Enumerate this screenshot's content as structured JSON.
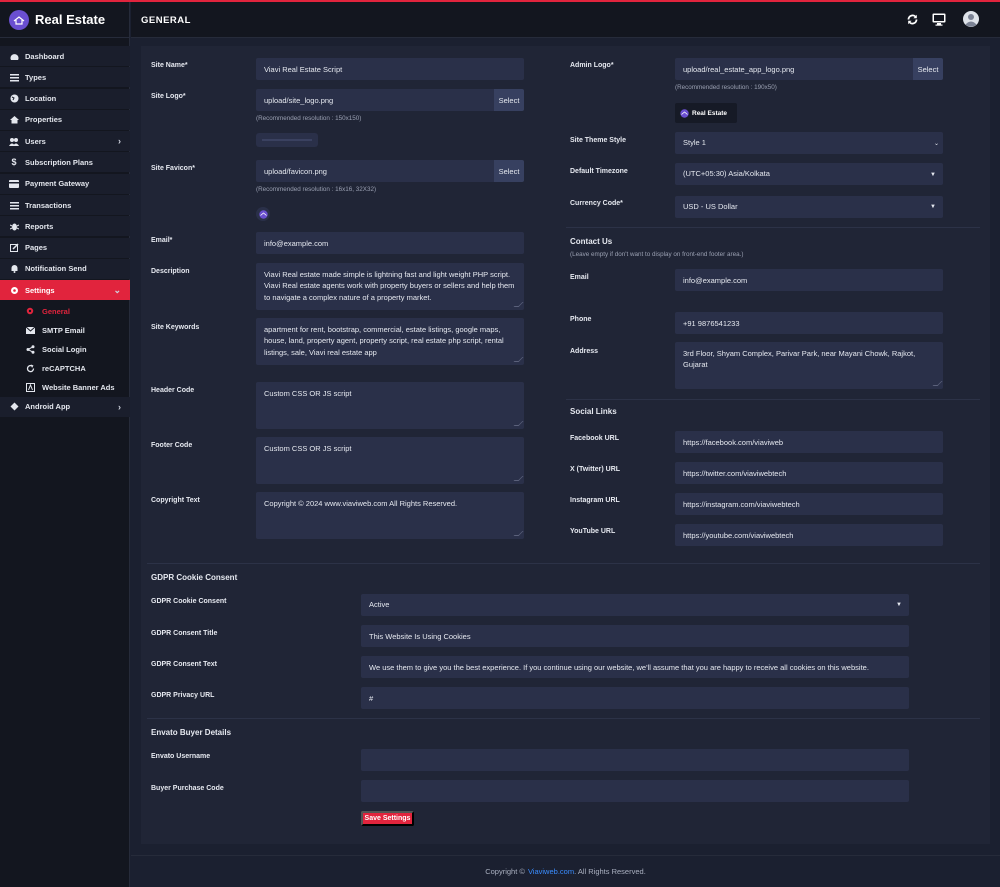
{
  "app": {
    "title": "Real Estate",
    "page_title": "GENERAL"
  },
  "sidebar": {
    "items": [
      {
        "label": "Dashboard"
      },
      {
        "label": "Types"
      },
      {
        "label": "Location"
      },
      {
        "label": "Properties"
      },
      {
        "label": "Users"
      },
      {
        "label": "Subscription Plans"
      },
      {
        "label": "Payment Gateway"
      },
      {
        "label": "Transactions"
      },
      {
        "label": "Reports"
      },
      {
        "label": "Pages"
      },
      {
        "label": "Notification Send"
      },
      {
        "label": "Settings"
      },
      {
        "label": "Android App"
      }
    ],
    "settings_sub": [
      {
        "label": "General"
      },
      {
        "label": "SMTP Email"
      },
      {
        "label": "Social Login"
      },
      {
        "label": "reCAPTCHA"
      },
      {
        "label": "Website Banner Ads"
      }
    ]
  },
  "left": {
    "site_name": {
      "label": "Site Name*",
      "value": "Viavi Real Estate Script"
    },
    "site_logo": {
      "label": "Site Logo*",
      "value": "upload/site_logo.png",
      "hint": "(Recommended resolution : 150x150)"
    },
    "site_favicon": {
      "label": "Site Favicon*",
      "value": "upload/favicon.png",
      "hint": "(Recommended resolution : 16x16, 32X32)"
    },
    "email": {
      "label": "Email*",
      "value": "info@example.com"
    },
    "description": {
      "label": "Description",
      "value": "Viavi Real estate made simple is lightning fast and light weight PHP script. Viavi Real estate agents work with property buyers or sellers and help them to navigate a complex nature of a property market."
    },
    "site_keywords": {
      "label": "Site Keywords",
      "value": "apartment for rent, bootstrap, commercial, estate listings, google maps, house, land, property agent, property script, real estate php script, rental listings, sale, Viavi real estate app"
    },
    "header_code": {
      "label": "Header Code",
      "value": "Custom CSS OR JS script"
    },
    "footer_code": {
      "label": "Footer Code",
      "value": "Custom CSS OR JS script"
    },
    "copyright": {
      "label": "Copyright Text",
      "value": "Copyright © 2024 www.viaviweb.com All Rights Reserved."
    }
  },
  "right": {
    "admin_logo": {
      "label": "Admin Logo*",
      "value": "upload/real_estate_app_logo.png",
      "hint": "(Recommended resolution : 190x50)",
      "preview_text": "Real Estate"
    },
    "theme": {
      "label": "Site Theme Style",
      "value": "Style 1"
    },
    "timezone": {
      "label": "Default Timezone",
      "value": "(UTC+05:30) Asia/Kolkata"
    },
    "currency": {
      "label": "Currency Code*",
      "value": "USD - US Dollar"
    },
    "contact": {
      "title": "Contact Us",
      "hint": "(Leave empty if don't want to display on front-end footer area.)"
    },
    "contact_email": {
      "label": "Email",
      "value": "info@example.com"
    },
    "phone": {
      "label": "Phone",
      "value": "+91 9876541233"
    },
    "address": {
      "label": "Address",
      "value": "3rd Floor, Shyam Complex, Parivar Park, near Mayani Chowk, Rajkot, Gujarat"
    },
    "social": {
      "title": "Social Links"
    },
    "facebook": {
      "label": "Facebook URL",
      "value": "https://facebook.com/viaviweb"
    },
    "twitter": {
      "label": "X (Twitter) URL",
      "value": "https://twitter.com/viaviwebtech"
    },
    "instagram": {
      "label": "Instagram URL",
      "value": "https://instagram.com/viaviwebtech"
    },
    "youtube": {
      "label": "YouTube URL",
      "value": "https://youtube.com/viaviwebtech"
    }
  },
  "select_label": "Select",
  "gdpr": {
    "title": "GDPR Cookie Consent",
    "consent": {
      "label": "GDPR Cookie Consent",
      "value": "Active"
    },
    "consent_title": {
      "label": "GDPR Consent Title",
      "value": "This Website Is Using Cookies"
    },
    "consent_text": {
      "label": "GDPR Consent Text",
      "value": "We use them to give you the best experience. If you continue using our website, we'll assume that you are happy to receive all cookies on this website."
    },
    "privacy_url": {
      "label": "GDPR Privacy URL",
      "value": "#"
    }
  },
  "envato": {
    "title": "Envato Buyer Details",
    "username": {
      "label": "Envato Username",
      "value": ""
    },
    "purchase_code": {
      "label": "Buyer Purchase Code",
      "value": ""
    }
  },
  "save_label": "Save Settings",
  "footer": {
    "prefix": "Copyright ©",
    "link": "Viaviweb.com",
    "suffix": ". All Rights Reserved."
  },
  "colors": {
    "accent": "#e1243d",
    "background": "#1b2030",
    "card": "#202536",
    "field": "#2a3049",
    "link": "#3a8dff",
    "brand": "#6a4fd1"
  }
}
